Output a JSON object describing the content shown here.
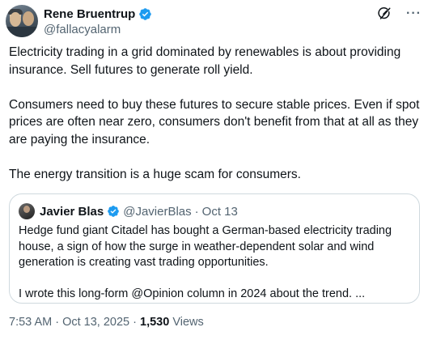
{
  "author": {
    "display_name": "Rene Bruentrup",
    "handle": "@fallacyalarm",
    "verified": true,
    "verified_color": "#1d9bf0"
  },
  "tweet": {
    "paragraphs": [
      "Electricity trading in a grid dominated by renewables is about providing insurance. Sell futures to generate roll yield.",
      "Consumers need to buy these futures to secure stable prices. Even if spot prices are often near zero, consumers don't benefit from that at all as they are paying the insurance.",
      "The energy transition is a huge scam for consumers."
    ]
  },
  "quote": {
    "display_name": "Javier Blas",
    "handle": "@JavierBlas",
    "separator": "·",
    "date": "Oct 13",
    "verified": true,
    "paragraphs": [
      "Hedge fund giant Citadel has bought a German-based electricity trading house, a sign of how the surge in weather-dependent solar and wind generation is creating vast trading opportunities.",
      "I wrote this long-form @Opinion column in 2024 about the trend. ..."
    ]
  },
  "footer": {
    "timestamp": "7:53 AM · Oct 13, 2025 · ",
    "views_count": "1,530",
    "views_label": " Views"
  },
  "icons": {
    "grok": "grok-icon",
    "more": "more-icon",
    "verified": "verified-badge-icon"
  },
  "colors": {
    "text_primary": "#0f1419",
    "text_secondary": "#536471",
    "border": "#cfd9de",
    "accent": "#1d9bf0"
  }
}
